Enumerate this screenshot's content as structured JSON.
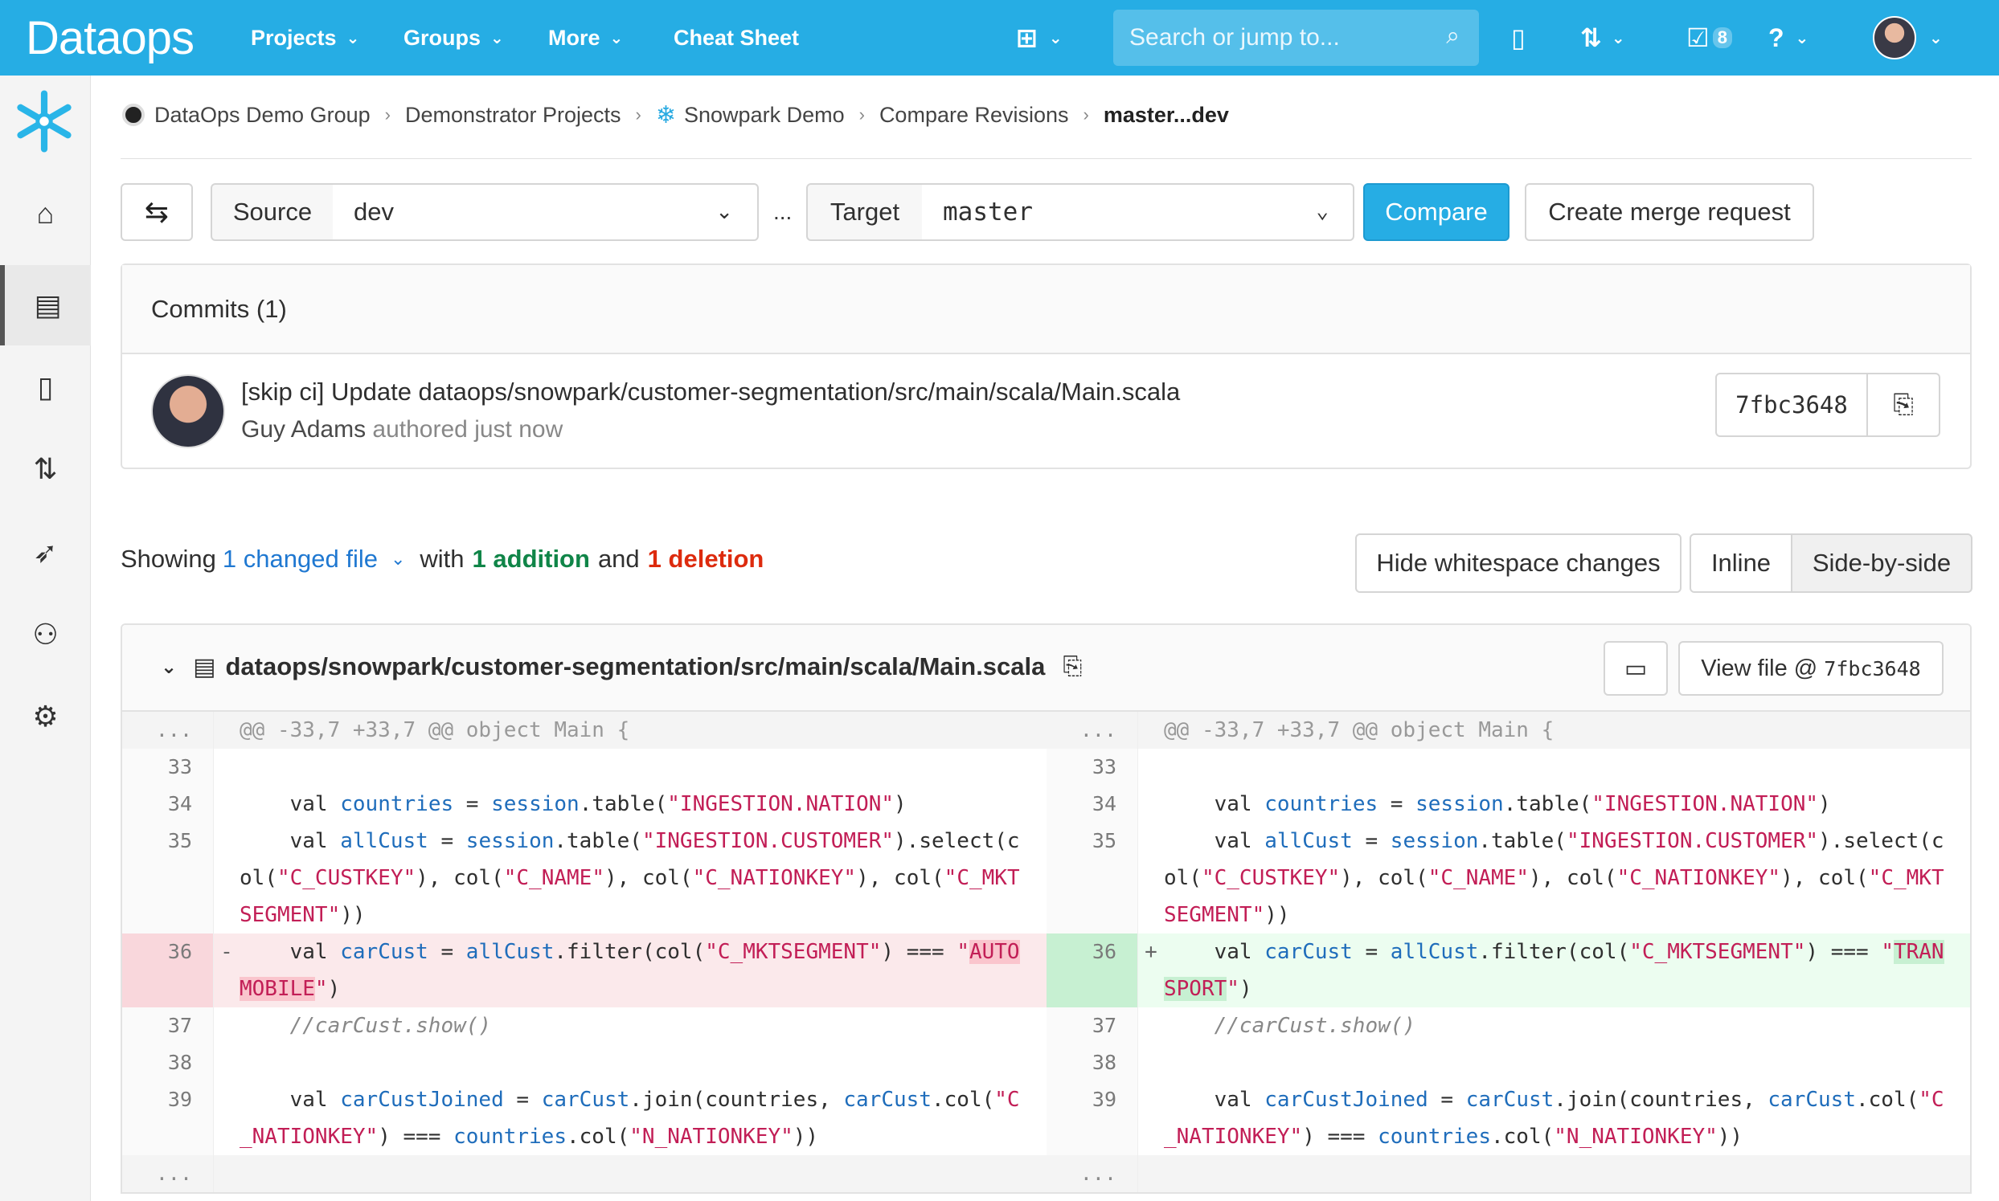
{
  "brand": {
    "name": "Dataops"
  },
  "topnav": {
    "items": [
      "Projects",
      "Groups",
      "More"
    ],
    "cheat_sheet": "Cheat Sheet",
    "search_placeholder": "Search or jump to...",
    "todo_count": "8"
  },
  "breadcrumb": [
    "DataOps Demo Group",
    "Demonstrator Projects",
    "Snowpark Demo",
    "Compare Revisions",
    "master...dev"
  ],
  "compare": {
    "source_label": "Source",
    "source_value": "dev",
    "separator": "...",
    "target_label": "Target",
    "target_value": "master",
    "compare_button": "Compare",
    "merge_request_button": "Create merge request"
  },
  "commits": {
    "header": "Commits (1)",
    "items": [
      {
        "title": "[skip ci] Update dataops/snowpark/customer-segmentation/src/main/scala/Main.scala",
        "author": "Guy Adams",
        "meta": "authored just now",
        "sha": "7fbc3648"
      }
    ]
  },
  "stats": {
    "showing": "Showing",
    "changed_files": "1 changed file",
    "with": "with",
    "additions": "1 addition",
    "and": "and",
    "deletions": "1 deletion",
    "hide_whitespace": "Hide whitespace changes",
    "inline": "Inline",
    "side_by_side": "Side-by-side"
  },
  "file": {
    "path": "dataops/snowpark/customer-segmentation/src/main/scala/Main.scala",
    "view_file": "View file @",
    "view_file_sha": "7fbc3648",
    "hunk": "@@ -33,7 +33,7 @@ object Main {",
    "ellipsis": "...",
    "old_changed_value": "AUTOMOBILE",
    "new_changed_value": "TRANSPORT"
  },
  "colors": {
    "brand": "#26ade4",
    "addition": "#108548",
    "deletion": "#dd2b0e",
    "link": "#1f78d1"
  }
}
